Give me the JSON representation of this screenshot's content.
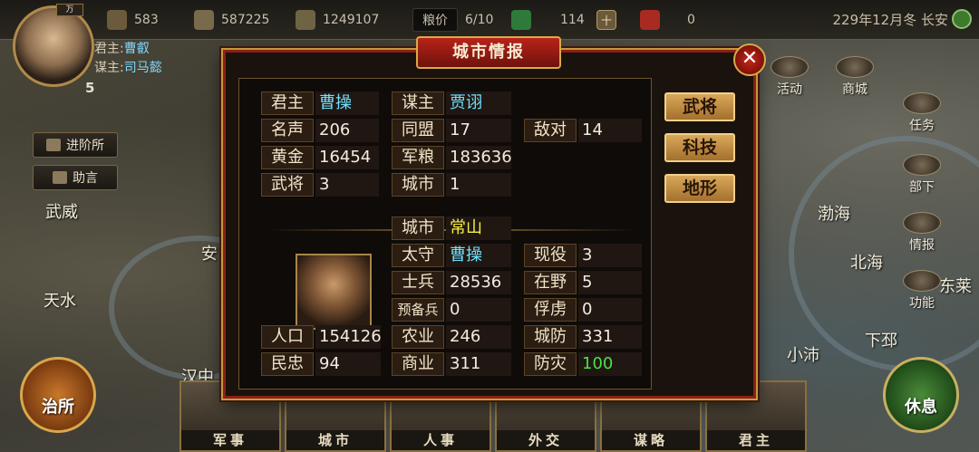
{
  "top": {
    "res1": "583",
    "res2": "587225",
    "res3": "1249107",
    "grain_label": "粮价",
    "grain_ratio": "6/10",
    "res5": "114",
    "res5_plus": "十",
    "res6": "0",
    "date": "229年12月冬 长安"
  },
  "player": {
    "lord_label": "君主:",
    "lord_name": "曹叡",
    "strategist_label": "谋主:",
    "strategist_name": "司马懿",
    "level": "5",
    "badge": "万"
  },
  "left_menu": {
    "jinpai": "进阶所",
    "zhuyan": "助言"
  },
  "map_labels": {
    "wuwei": "武威",
    "an": "安",
    "tianshui": "天水",
    "hanzhong": "汉中",
    "bohai": "渤海",
    "beihai": "北海",
    "donglai": "东莱",
    "xiaopei": "小沛",
    "xiapi": "下邳"
  },
  "right_icons": {
    "huodong": "活动",
    "shangcheng": "商城",
    "renwu": "任务",
    "buxia": "部下",
    "qingbao": "情报",
    "gongneng": "功能"
  },
  "bottom": {
    "zhisuo": "治所",
    "xiuxi": "休息",
    "tabs": [
      "军事",
      "城市",
      "人事",
      "外交",
      "谋略",
      "君主"
    ]
  },
  "dialog": {
    "title": "城市情报",
    "close": "✕",
    "r1": {
      "l1": "君主",
      "v1": "曹操",
      "l2": "谋主",
      "v2": "贾诩"
    },
    "r2": {
      "l1": "名声",
      "v1": "206",
      "l2": "同盟",
      "v2": "17",
      "l3": "敌对",
      "v3": "14"
    },
    "r3": {
      "l1": "黄金",
      "v1": "16454",
      "l2": "军粮",
      "v2": "183636"
    },
    "r4": {
      "l1": "武将",
      "v1": "3",
      "l2": "城市",
      "v2": "1"
    },
    "city": {
      "l": "城市",
      "v": "常山"
    },
    "taishou": {
      "l": "太守",
      "v": "曹操",
      "l2": "现役",
      "v2": "3"
    },
    "soldiers": {
      "l": "士兵",
      "v": "28536",
      "l2": "在野",
      "v2": "5"
    },
    "reserve": {
      "l": "预备兵",
      "v": "0",
      "l2": "俘虏",
      "v2": "0"
    },
    "pop": {
      "l0": "人口",
      "v0": "154126",
      "l": "农业",
      "v": "246",
      "l2": "城防",
      "v2": "331"
    },
    "loyal": {
      "l0": "民忠",
      "v0": "94",
      "l": "商业",
      "v": "311",
      "l2": "防灾",
      "v2": "100"
    },
    "buttons": [
      "武将",
      "科技",
      "地形"
    ]
  }
}
